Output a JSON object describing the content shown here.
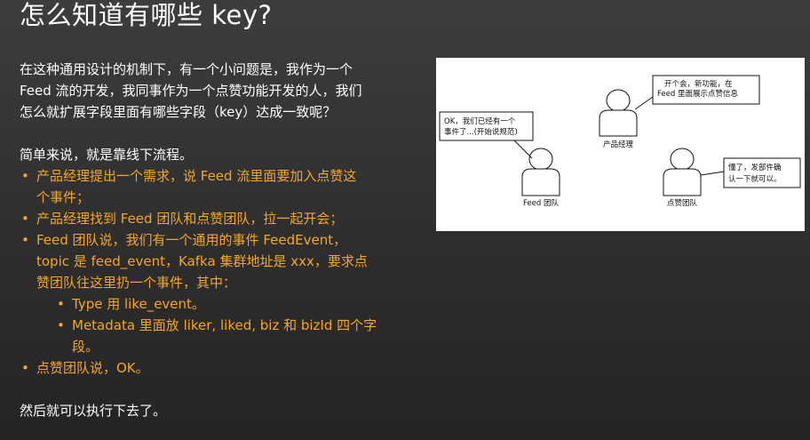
{
  "title": "怎么知道有哪些 key?",
  "intro": [
    "在这种通用设计的机制下，有一个小问题是，我作为一个",
    "Feed 流的开发，我同事作为一个点赞功能开发的人，我们",
    "怎么就扩展字段里面有哪些字段（key）达成一致呢？"
  ],
  "summary_line": "简单来说，就是靠线下流程。",
  "bullets": {
    "b1": [
      "产品经理提出一个需求，说 Feed 流里面要加入点赞这",
      "个事件；"
    ],
    "b2": [
      "产品经理找到 Feed 团队和点赞团队，拉一起开会；"
    ],
    "b3": [
      "Feed 团队说，我们有一个通用的事件 FeedEvent，",
      "topic 是 feed_event，Kafka 集群地址是 xxx，要求点",
      "赞团队往这里扔一个事件，其中："
    ],
    "sub1": [
      "Type 用 like_event。"
    ],
    "sub2": [
      "Metadata 里面放 liker, liked, biz 和 bizId 四个字",
      "段。"
    ],
    "b4": [
      "点赞团队说，OK。"
    ]
  },
  "closing": "然后就可以执行下去了。",
  "diagram": {
    "pm_label": "产品经理",
    "pm_note": [
      "开个会，新功能，在",
      "Feed 里面展示点赞信息"
    ],
    "feed_label": "Feed 团队",
    "feed_note": [
      "OK，我们已经有一个",
      "事件了...(开始说规范)"
    ],
    "like_label": "点赞团队",
    "like_note": [
      "懂了，发部件确",
      "认一下就可以。"
    ]
  },
  "colors": {
    "accent": "#f5a623",
    "text": "#ffffff",
    "background_top": "#3d3d3d",
    "background_bottom": "#242424"
  }
}
